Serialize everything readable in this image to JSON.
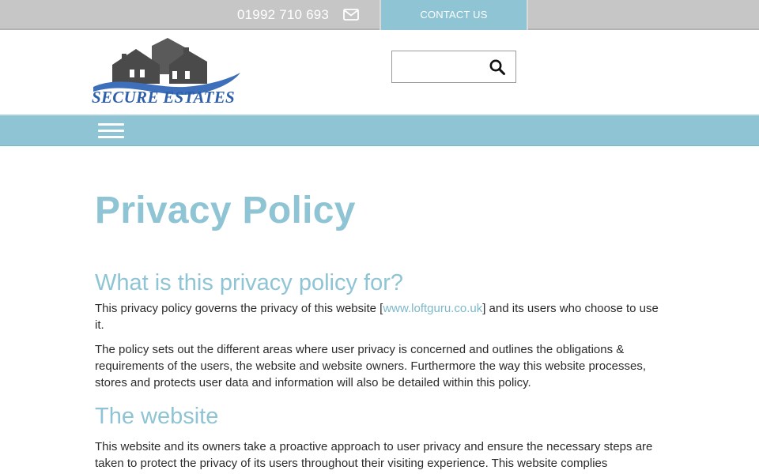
{
  "topbar": {
    "phone": "01992 710 693",
    "mail_icon": "envelope-icon",
    "contact_label": "CONTACT US"
  },
  "header": {
    "logo_text": "SECURE ESTATES",
    "search": {
      "value": "",
      "placeholder": "",
      "icon": "magnifier-icon"
    }
  },
  "nav": {
    "menu_icon": "hamburger-menu-icon"
  },
  "colors": {
    "accent": "#8ec4d3",
    "topbar_bg": "#c6c6c6",
    "logo_blue": "#2f5fa8",
    "logo_houses": "#4a4a4a",
    "link": "#7cb8c9"
  },
  "page": {
    "title": "Privacy Policy",
    "sections": [
      {
        "heading": "What is this privacy policy for?",
        "p1_before": "This privacy policy governs the privacy of this website [",
        "p1_link": "www.loftguru.co.uk",
        "p1_after": "] and its users who choose to use it.",
        "p2": "The policy sets out the different areas where user privacy is concerned and outlines the obligations & requirements of the users, the website and website owners. Furthermore the way this website processes, stores and protects user data and information will also be detailed within this policy."
      },
      {
        "heading": "The website",
        "p1": "This website and its owners take a proactive approach to user privacy and ensure the necessary steps are taken to protect the privacy of its users throughout their visiting experience. This website complies"
      }
    ]
  }
}
